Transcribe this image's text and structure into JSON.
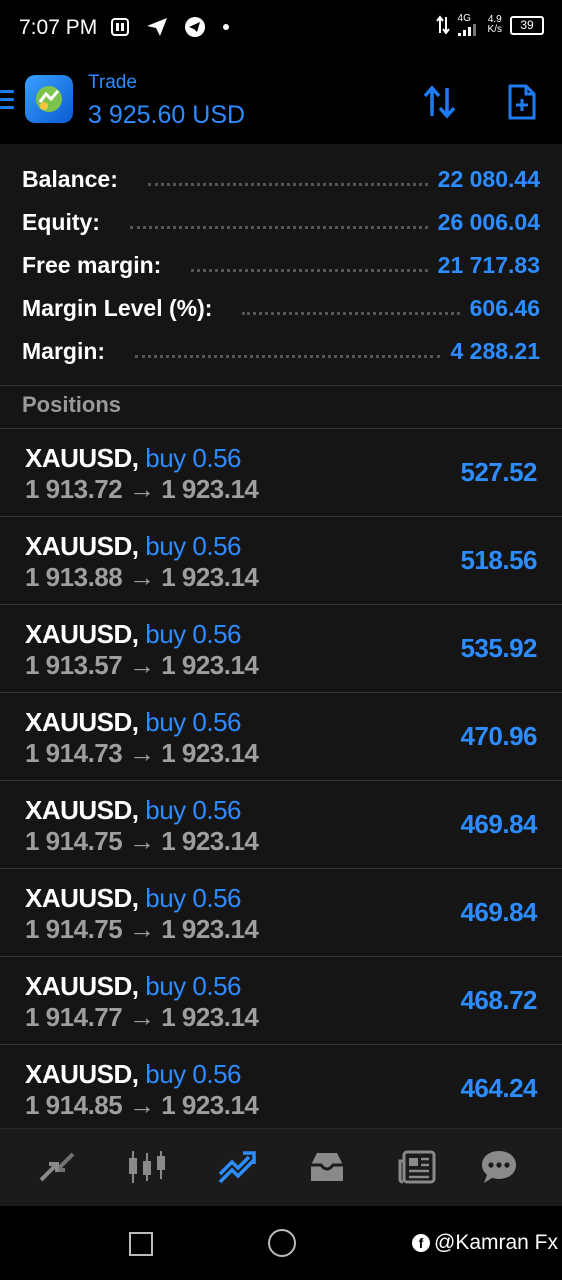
{
  "status": {
    "time": "7:07 PM",
    "network": "4G",
    "speed_value": "4.9",
    "speed_unit": "K/s",
    "battery": "39"
  },
  "header": {
    "title": "Trade",
    "balance": "3 925.60 USD"
  },
  "summary": {
    "balance_label": "Balance:",
    "balance_value": "22 080.44",
    "equity_label": "Equity:",
    "equity_value": "26 006.04",
    "free_margin_label": "Free margin:",
    "free_margin_value": "21 717.83",
    "margin_level_label": "Margin Level (%):",
    "margin_level_value": "606.46",
    "margin_label": "Margin:",
    "margin_value": "4 288.21"
  },
  "positions_title": "Positions",
  "positions": [
    {
      "symbol": "XAUUSD,",
      "side": "buy 0.56",
      "open": "1 913.72",
      "arrow": "→",
      "current": "1 923.14",
      "profit": "527.52"
    },
    {
      "symbol": "XAUUSD,",
      "side": "buy 0.56",
      "open": "1 913.88",
      "arrow": "→",
      "current": "1 923.14",
      "profit": "518.56"
    },
    {
      "symbol": "XAUUSD,",
      "side": "buy 0.56",
      "open": "1 913.57",
      "arrow": "→",
      "current": "1 923.14",
      "profit": "535.92"
    },
    {
      "symbol": "XAUUSD,",
      "side": "buy 0.56",
      "open": "1 914.73",
      "arrow": "→",
      "current": "1 923.14",
      "profit": "470.96"
    },
    {
      "symbol": "XAUUSD,",
      "side": "buy 0.56",
      "open": "1 914.75",
      "arrow": "→",
      "current": "1 923.14",
      "profit": "469.84"
    },
    {
      "symbol": "XAUUSD,",
      "side": "buy 0.56",
      "open": "1 914.75",
      "arrow": "→",
      "current": "1 923.14",
      "profit": "469.84"
    },
    {
      "symbol": "XAUUSD,",
      "side": "buy 0.56",
      "open": "1 914.77",
      "arrow": "→",
      "current": "1 923.14",
      "profit": "468.72"
    },
    {
      "symbol": "XAUUSD,",
      "side": "buy 0.56",
      "open": "1 914.85",
      "arrow": "→",
      "current": "1 923.14",
      "profit": "464.24"
    }
  ],
  "tabs": [
    {
      "icon": "quotes-icon",
      "active": false
    },
    {
      "icon": "chart-icon",
      "active": false
    },
    {
      "icon": "trade-icon",
      "active": true
    },
    {
      "icon": "history-icon",
      "active": false
    },
    {
      "icon": "news-icon",
      "active": false
    },
    {
      "icon": "chat-icon",
      "active": false
    }
  ],
  "watermark": "@Kamran Fx",
  "colors": {
    "accent": "#2d8cff",
    "background": "#151515",
    "muted_text": "#9e9e9e"
  }
}
